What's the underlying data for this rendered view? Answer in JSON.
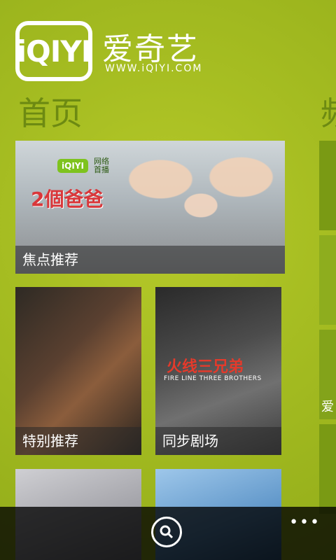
{
  "logo": {
    "mark": "iQIYI",
    "cn": "爱奇艺",
    "url": "WWW.iQIYI.COM"
  },
  "page": {
    "title": "首页",
    "next_title_partial": "频"
  },
  "tiles": [
    {
      "label": "焦点推荐",
      "mini_logo": "iQIYI",
      "mini_logo_caption": "网络\n首播",
      "poster_text": "2個爸爸"
    },
    {
      "label": "特别推荐"
    },
    {
      "label": "同步剧场",
      "poster_title": "火线三兄弟",
      "poster_sub": "FIRE LINE THREE BROTHERS"
    },
    {
      "label": ""
    },
    {
      "label": ""
    }
  ],
  "right_column": {
    "label": "爱"
  },
  "app_bar": {
    "search_icon": "search-icon",
    "more_label": "•••"
  }
}
